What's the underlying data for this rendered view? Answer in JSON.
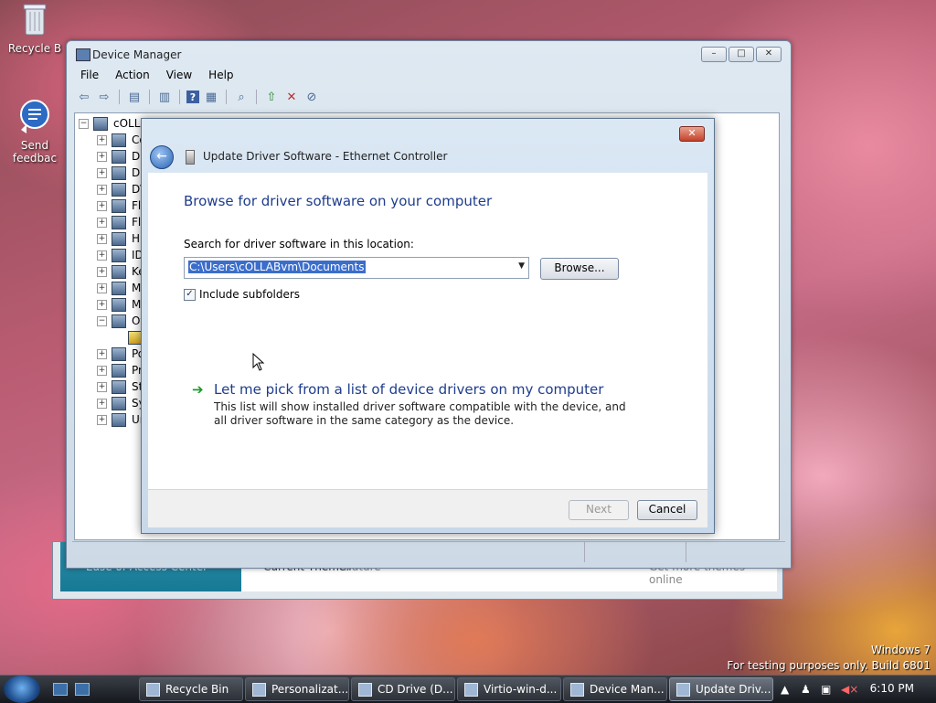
{
  "desktop": {
    "icons": [
      {
        "label": "Recycle B"
      },
      {
        "label": "Send feedbac"
      }
    ],
    "watermark": {
      "line1": "Windows 7",
      "line2": "For testing purposes only. Build 6801"
    }
  },
  "control_panel": {
    "left_link": "Ease of Access Center",
    "current_theme_label": "Current Theme:",
    "current_theme_value": "Nature",
    "more_themes": "Get more themes online"
  },
  "device_manager": {
    "title": "Device Manager",
    "menu": [
      "File",
      "Action",
      "View",
      "Help"
    ],
    "tree": {
      "root": "cOLLA",
      "items": [
        "Co",
        "Di",
        "Di",
        "DV",
        "Fl",
        "Fl",
        "Hu",
        "ID",
        "Ke",
        "M",
        "M",
        "Ot",
        "",
        "Po",
        "Pr",
        "St",
        "Sy",
        "Ur"
      ]
    }
  },
  "dialog": {
    "title": "Update Driver Software - Ethernet Controller",
    "heading": "Browse for driver software on your computer",
    "search_label": "Search for driver software in this location:",
    "path_value": "C:\\Users\\cOLLABvm\\Documents",
    "browse_label": "Browse...",
    "include_subfolders_label": "Include subfolders",
    "include_subfolders_checked": true,
    "pick_title": "Let me pick from a list of device drivers on my computer",
    "pick_desc": "This list will show installed driver software compatible with the device, and all driver software in the same category as the device.",
    "next_label": "Next",
    "cancel_label": "Cancel"
  },
  "taskbar": {
    "tasks": [
      {
        "label": "Recycle Bin"
      },
      {
        "label": "Personalizat..."
      },
      {
        "label": "CD Drive (D..."
      },
      {
        "label": "Virtio-win-d..."
      },
      {
        "label": "Device Man..."
      },
      {
        "label": "Update Driv..."
      }
    ],
    "clock": "6:10 PM"
  }
}
